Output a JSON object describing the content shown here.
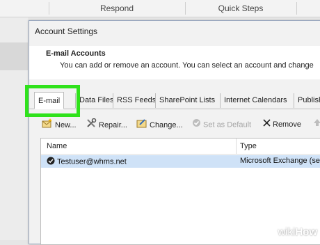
{
  "ribbon": {
    "groups": [
      "Respond",
      "Quick Steps"
    ]
  },
  "dialog": {
    "title": "Account Settings",
    "header_title": "E-mail Accounts",
    "header_subtitle": "You can add or remove an account. You can select an account and change"
  },
  "tabs": [
    "E-mail",
    "Data Files",
    "RSS Feeds",
    "SharePoint Lists",
    "Internet Calendars",
    "Publish"
  ],
  "toolbar": {
    "new": "New...",
    "repair": "Repair...",
    "change": "Change...",
    "set_default": "Set as Default",
    "remove": "Remove"
  },
  "list": {
    "columns": [
      "Name",
      "Type"
    ],
    "rows": [
      {
        "name": "Testuser@whms.net",
        "type": "Microsoft Exchange (se"
      }
    ]
  },
  "watermark": {
    "prefix": "wiki",
    "suffix": "How"
  },
  "colors": {
    "highlight": "#2fe21b",
    "selected_row": "#cfe2f7"
  },
  "icons": [
    "new-account-icon",
    "repair-icon",
    "change-icon",
    "set-default-icon",
    "remove-x-icon",
    "move-up-icon",
    "default-check-icon"
  ]
}
